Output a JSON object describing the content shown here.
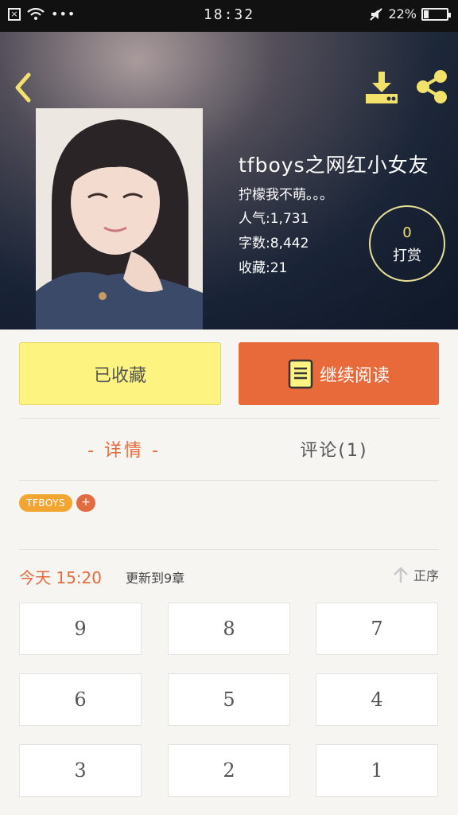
{
  "status_bar": {
    "time": "18:32",
    "battery": "22%",
    "battery_level": 0.22,
    "icons": [
      "close-box-icon",
      "wifi-icon",
      "more-dots-icon",
      "mute-icon",
      "battery-icon"
    ]
  },
  "header": {
    "icons": [
      "back-icon",
      "download-icon",
      "share-icon"
    ]
  },
  "book": {
    "title": "tfboys之网红小女友",
    "description": "拧檬我不萌。。。",
    "popularity": "人气:1,731",
    "word_count": "字数:8,442",
    "favorites": "收藏:21",
    "tip_count": "0",
    "tip_label": "打赏"
  },
  "actions": {
    "favorite_label": "已收藏",
    "read_label": "继续阅读",
    "read_icon": "book-icon"
  },
  "tabs": {
    "detail": "- 详情 -",
    "comment": "评论(1)"
  },
  "tags": {
    "items": [
      "TFBOYS"
    ],
    "add_label": "+"
  },
  "update": {
    "time": "今天 15:20",
    "text": "更新到9章",
    "sort_label": "正序",
    "sort_icon": "arrow-up-icon"
  },
  "chapters": [
    "9",
    "8",
    "7",
    "6",
    "5",
    "4",
    "3",
    "2",
    "1"
  ],
  "colors": {
    "accent": "#e8693a",
    "favorite_bg": "#fdf381",
    "tag": "#f2a531"
  }
}
